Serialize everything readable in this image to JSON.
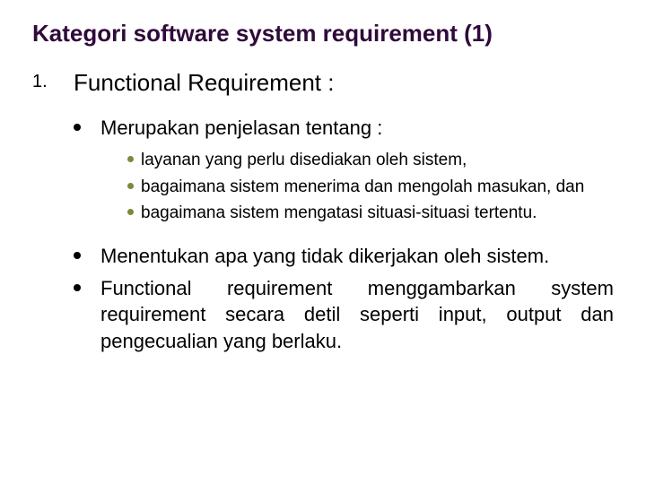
{
  "slide": {
    "title": "Kategori software system requirement (1)",
    "list_number": "1.",
    "heading": "Functional Requirement :",
    "bullets": [
      {
        "text": "Merupakan penjelasan tentang :",
        "children": [
          "layanan yang perlu disediakan oleh sistem,",
          "bagaimana sistem menerima dan mengolah masukan, dan",
          "bagaimana sistem mengatasi situasi-situasi tertentu."
        ]
      },
      {
        "text": "Menentukan apa yang tidak dikerjakan oleh sistem."
      },
      {
        "text": "Functional requirement menggambarkan system requirement secara detil seperti input, output dan pengecualian yang berlaku."
      }
    ]
  }
}
